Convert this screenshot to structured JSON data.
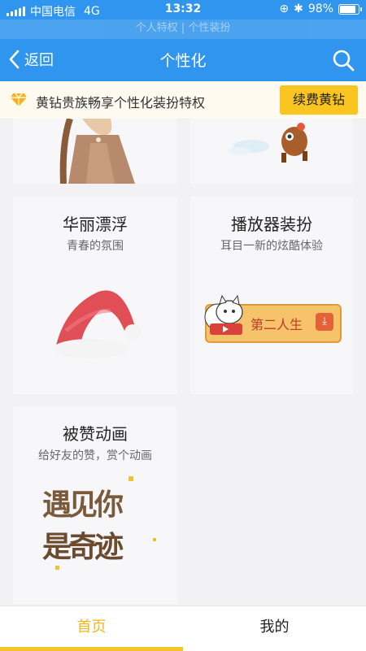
{
  "status": {
    "carrier": "中国电信",
    "network": "4G",
    "time": "13:32",
    "battery": "98%"
  },
  "ghost_tabs": "个人特权 | 个性装扮",
  "nav": {
    "back_label": "返回",
    "title": "个性化"
  },
  "vip": {
    "text": "黄钻贵族畅享个性化装扮特权",
    "button": "续费黄钻"
  },
  "cards": [
    {
      "title": "华丽漂浮",
      "subtitle": "青春的氛围"
    },
    {
      "title": "播放器装扮",
      "subtitle": "耳目一新的炫酷体验",
      "player_text": "第二人生"
    },
    {
      "title": "被赞动画",
      "subtitle": "给好友的赞，赏个动画",
      "art_text": [
        "遇见你",
        "是奇迹"
      ]
    }
  ],
  "tabs": [
    {
      "label": "首页",
      "active": true
    },
    {
      "label": "我的",
      "active": false
    }
  ],
  "colors": {
    "primary": "#2f95ee",
    "accent": "#f9c51e",
    "active_tab": "#f2b51e"
  }
}
